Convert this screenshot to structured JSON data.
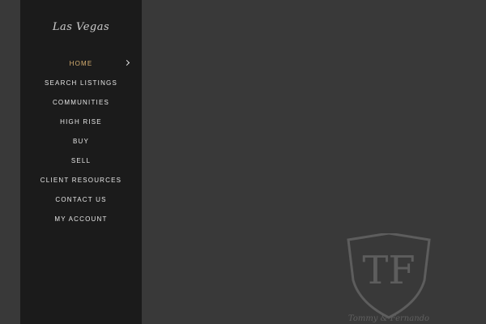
{
  "brand": {
    "logo_text": "Las Vegas"
  },
  "nav": {
    "items": [
      {
        "label": "HOME",
        "active": true
      },
      {
        "label": "SEARCH LISTINGS",
        "active": false
      },
      {
        "label": "COMMUNITIES",
        "active": false
      },
      {
        "label": "HIGH RISE",
        "active": false
      },
      {
        "label": "BUY",
        "active": false
      },
      {
        "label": "SELL",
        "active": false
      },
      {
        "label": "CLIENT RESOURCES",
        "active": false
      },
      {
        "label": "CONTACT US",
        "active": false
      },
      {
        "label": "MY ACCOUNT",
        "active": false
      }
    ]
  },
  "watermark": {
    "monogram": "TF",
    "caption": "Tommy & Fernando"
  },
  "colors": {
    "sidebar_bg": "#1b1b1b",
    "page_bg": "#393939",
    "active_nav": "#d8b071",
    "nav_text": "#e6e6e6"
  }
}
